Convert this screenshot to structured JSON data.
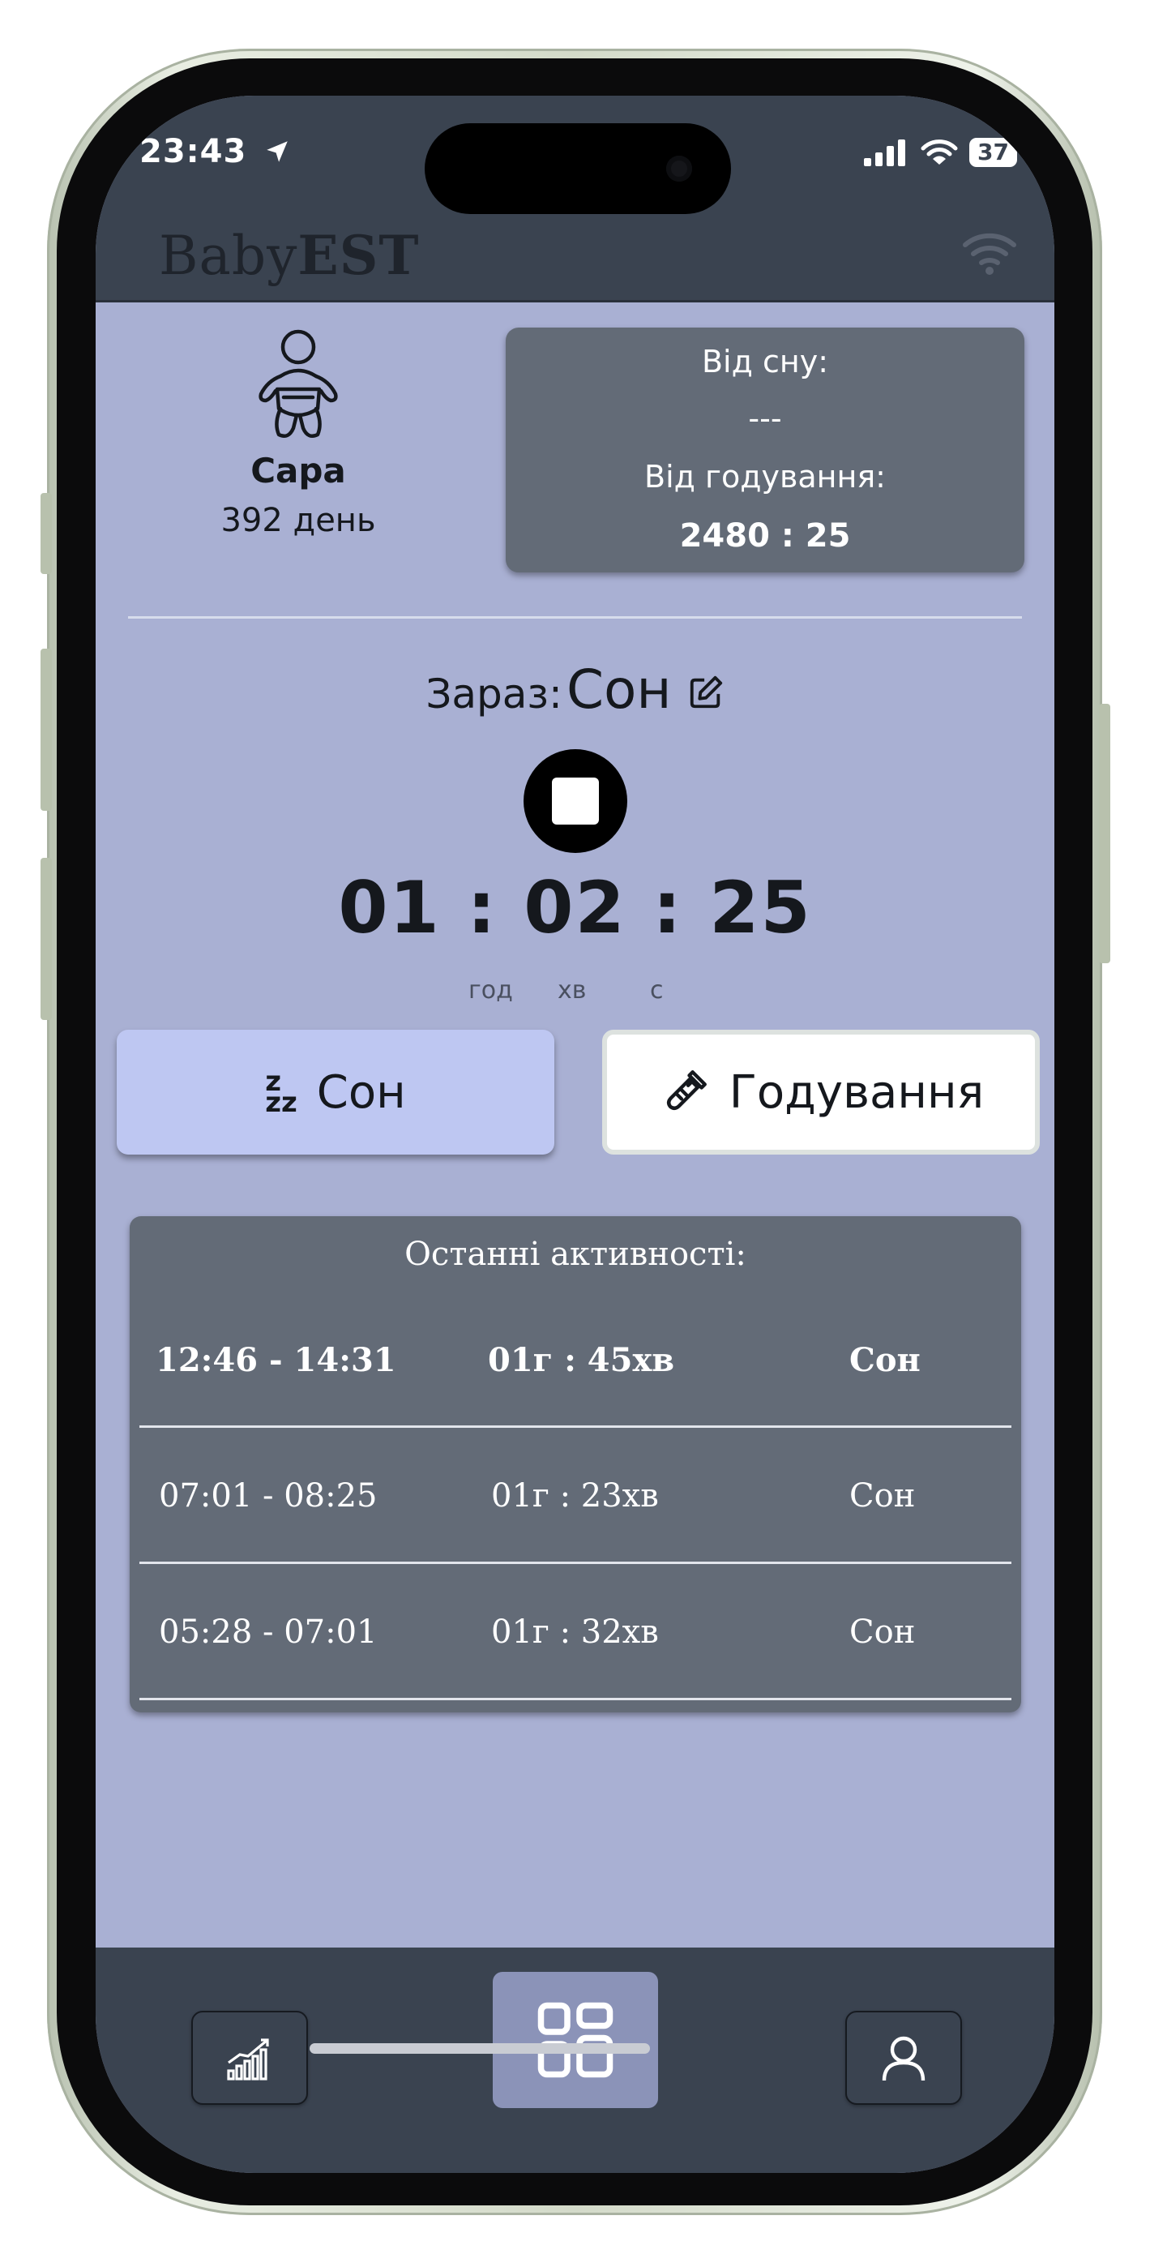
{
  "status_bar": {
    "time": "23:43",
    "battery": "37"
  },
  "app": {
    "title_prefix": "Baby",
    "title_suffix": "EST"
  },
  "baby": {
    "name": "Сара",
    "age": "392 день"
  },
  "since": {
    "sleep_label": "Від сну:",
    "sleep_value": "---",
    "feeding_label": "Від годування:",
    "feeding_value": "2480 : 25"
  },
  "current": {
    "label": "Зараз:",
    "value": "Сон"
  },
  "timer": {
    "hours": "01",
    "minutes": "02",
    "seconds": "25",
    "sep": ":",
    "unit_hours": "год",
    "unit_minutes": "хв",
    "unit_seconds": "с"
  },
  "actions": {
    "sleep_label": "Сон",
    "feeding_label": "Годування"
  },
  "activities": {
    "title": "Останні активності:",
    "rows": [
      {
        "range": "12:46 - 14:31",
        "duration": "01г : 45хв",
        "type": "Сон"
      },
      {
        "range": "07:01 - 08:25",
        "duration": "01г : 23хв",
        "type": "Сон"
      },
      {
        "range": "05:28 - 07:01",
        "duration": "01г : 32хв",
        "type": "Сон"
      }
    ]
  },
  "colors": {
    "background": "#a9b0d3",
    "bars": "#3a4350",
    "card": "#636b77",
    "sleep_button": "#bec7f2",
    "nav_active": "#8b93b8"
  },
  "icons": {
    "baby": "baby-icon",
    "edit": "edit-icon",
    "stop": "stop-icon",
    "sleep": "zzz-icon",
    "feeding": "bottle-icon",
    "stats": "chart-icon",
    "home": "grid-icon",
    "profile": "user-icon",
    "wifi": "wifi-icon"
  }
}
